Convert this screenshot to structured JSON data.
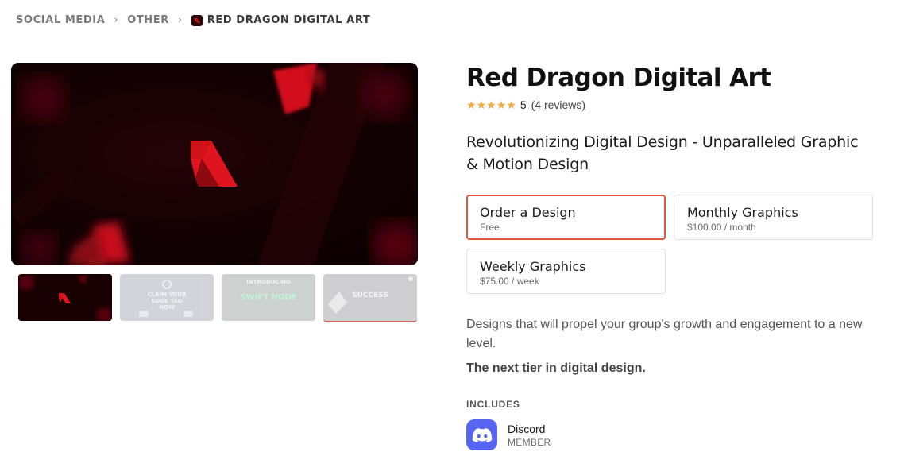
{
  "breadcrumb": {
    "items": [
      "SOCIAL MEDIA",
      "OTHER"
    ],
    "current": "RED DRAGON DIGITAL ART"
  },
  "product": {
    "title": "Red Dragon Digital Art",
    "rating_value": "5",
    "reviews_text": "(4 reviews)",
    "stars": 5,
    "tagline": "Revolutionizing Digital Design - Unparalleled Graphic & Motion Design",
    "description": "Designs that will propel your group's growth and engagement to a new level.",
    "highlight": "The next tier in digital design."
  },
  "plans": [
    {
      "name": "Order a Design",
      "price": "Free",
      "selected": true
    },
    {
      "name": "Monthly Graphics",
      "price": "$100.00 / month",
      "selected": false
    },
    {
      "name": "Weekly Graphics",
      "price": "$75.00 / week",
      "selected": false
    }
  ],
  "gallery": {
    "thumb2_text": "CLAIM YOUR EDGE TAG NOW",
    "thumb3_line1": "INTRODUCING",
    "thumb3_line2": "SWIFT NODE",
    "thumb4_text": "SUCCESS"
  },
  "includes": {
    "label": "INCLUDES",
    "items": [
      {
        "name": "Discord",
        "role": "MEMBER",
        "icon": "discord-icon"
      }
    ]
  },
  "colors": {
    "accent": "#e8543a",
    "star": "#f2a93b",
    "discord": "#5865f2",
    "brand_red": "#e0141e"
  }
}
